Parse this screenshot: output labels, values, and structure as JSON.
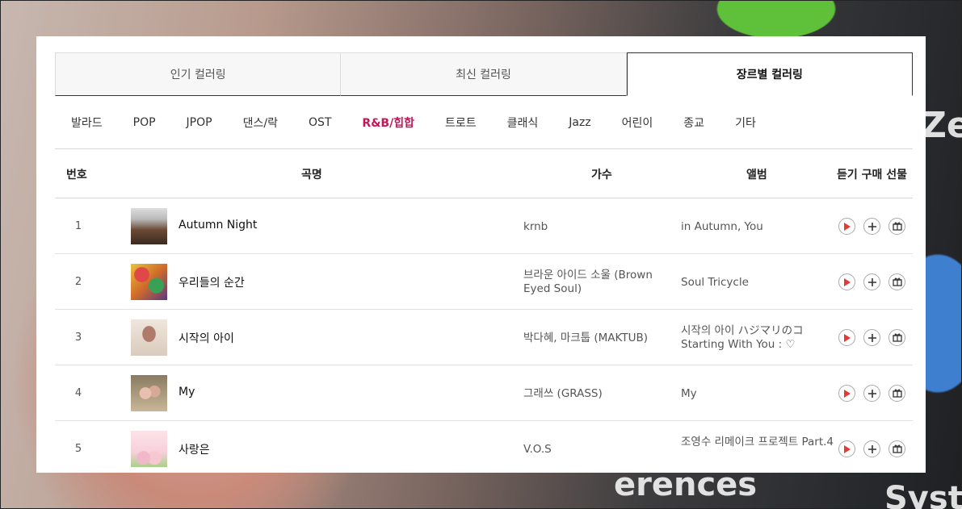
{
  "tabs": [
    {
      "label": "인기 컬러링",
      "active": false
    },
    {
      "label": "최신 컬러링",
      "active": false
    },
    {
      "label": "장르별 컬러링",
      "active": true
    }
  ],
  "genres": [
    "발라드",
    "POP",
    "JPOP",
    "댄스/락",
    "OST",
    "R&B/힙합",
    "트로트",
    "클래식",
    "Jazz",
    "어린이",
    "종교",
    "기타"
  ],
  "active_genre": "R&B/힙합",
  "columns": {
    "number": "번호",
    "title": "곡명",
    "artist": "가수",
    "album": "앨범",
    "actions": "듣기 구매 선물"
  },
  "rows": [
    {
      "number": "1",
      "title": "Autumn Night",
      "artist": "krnb",
      "album": "in Autumn, You"
    },
    {
      "number": "2",
      "title": "우리들의 순간",
      "artist": "브라운 아이드 소울 (Brown Eyed Soul)",
      "album": "Soul Tricycle"
    },
    {
      "number": "3",
      "title": "시작의 아이",
      "artist": "박다혜, 마크툽 (MAKTUB)",
      "album": "시작의 아이 ハジマリのコ Starting With You : ♡"
    },
    {
      "number": "4",
      "title": "My",
      "artist": "그래쓰 (GRASS)",
      "album": "My"
    },
    {
      "number": "5",
      "title": "사랑은",
      "artist": "V.O.S",
      "album": "조영수 리메이크 프로젝트 Part.4"
    }
  ],
  "background_text": {
    "ze": "Ze",
    "ences": "erences",
    "syst": "Syst"
  },
  "colors": {
    "accent": "#c2185b",
    "play": "#e53935"
  }
}
